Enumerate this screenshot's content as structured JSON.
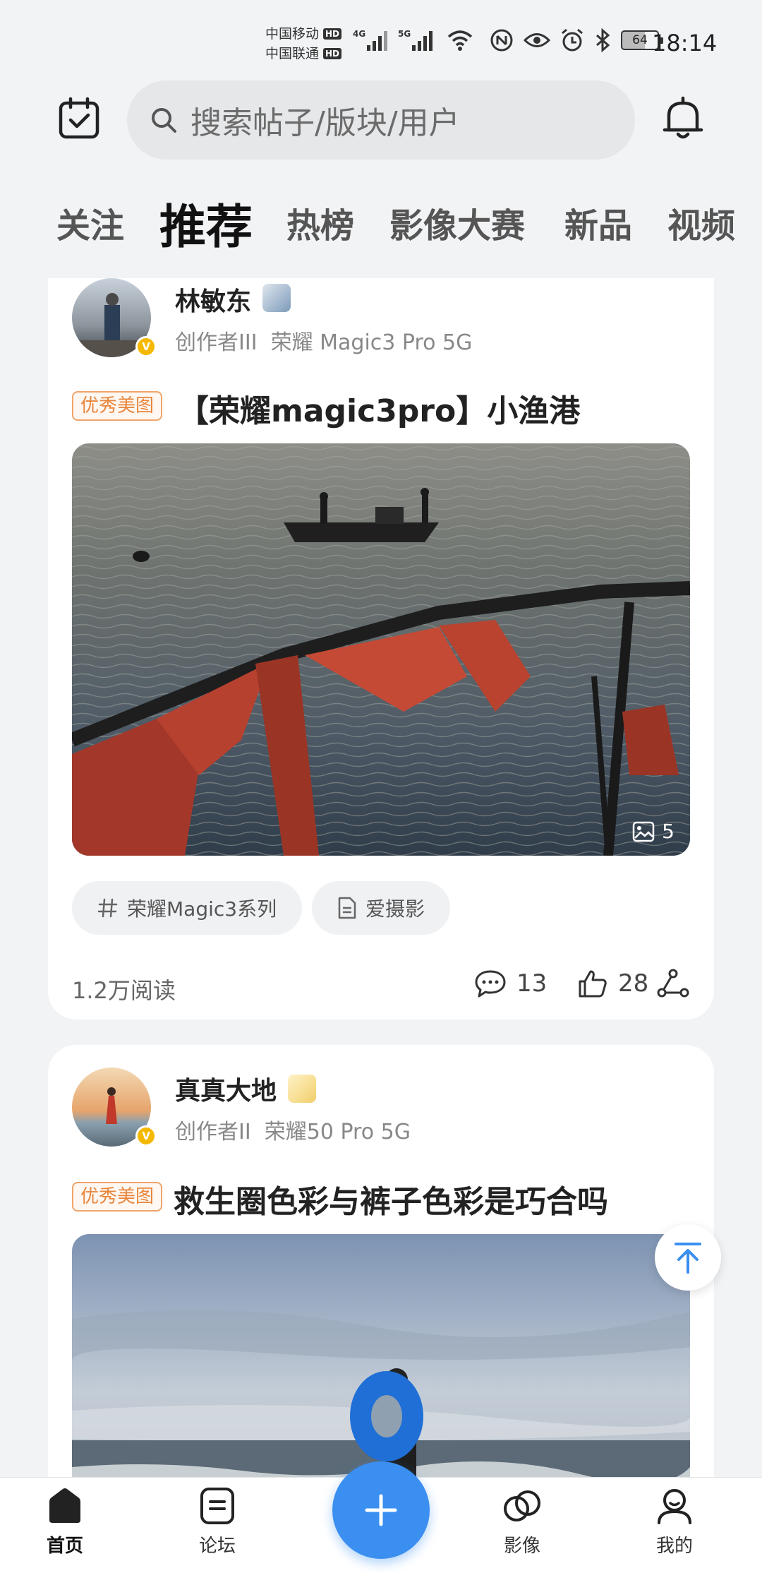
{
  "status_bar": {
    "carrier1": "中国移动",
    "carrier2": "中国联通",
    "hd": "HD",
    "net1": "4G",
    "net2": "5G",
    "battery": "64",
    "time": "18:14"
  },
  "top_bar": {
    "search_placeholder": "搜索帖子/版块/用户"
  },
  "tabs": [
    {
      "label": "关注",
      "active": false
    },
    {
      "label": "推荐",
      "active": true
    },
    {
      "label": "热榜",
      "active": false
    },
    {
      "label": "影像大赛",
      "active": false
    },
    {
      "label": "新品",
      "active": false
    },
    {
      "label": "视频",
      "active": false
    }
  ],
  "posts": [
    {
      "author": "林敏东",
      "verified": "V",
      "level": "创作者III",
      "device": "荣耀 Magic3 Pro 5G",
      "tag": "优秀美图",
      "title": "【荣耀magic3pro】小渔港",
      "image_count": "5",
      "chips": [
        {
          "icon": "hash-icon",
          "label": "荣耀Magic3系列"
        },
        {
          "icon": "document-icon",
          "label": "爱摄影"
        }
      ],
      "reads": "1.2万阅读",
      "comments": "13",
      "likes": "28"
    },
    {
      "author": "真真大地",
      "verified": "V",
      "level": "创作者II",
      "device": "荣耀50 Pro 5G",
      "tag": "优秀美图",
      "title": "救生圈色彩与裤子色彩是巧合吗"
    }
  ],
  "bottom_nav": [
    {
      "label": "首页",
      "icon": "home-icon",
      "active": true
    },
    {
      "label": "论坛",
      "icon": "forum-icon",
      "active": false
    },
    {
      "label": "影像",
      "icon": "imaging-icon",
      "active": false
    },
    {
      "label": "我的",
      "icon": "profile-icon",
      "active": false
    }
  ],
  "colors": {
    "accent": "#3a8ff0",
    "tag_orange": "#e8853c",
    "background": "#f1f3f5"
  }
}
